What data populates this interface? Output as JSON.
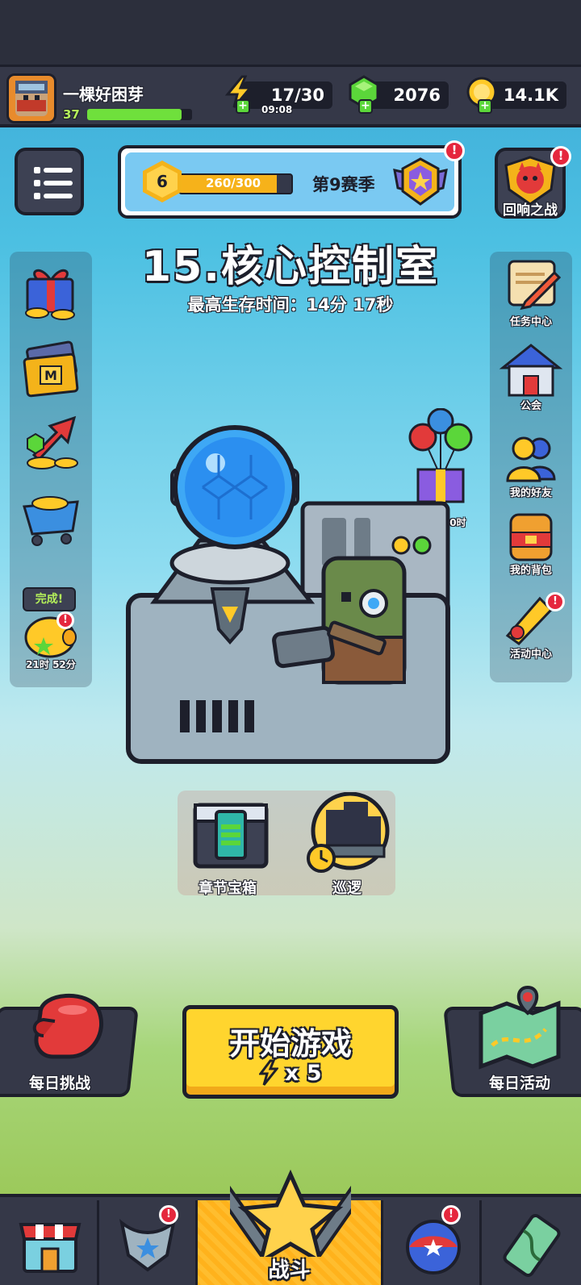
{
  "player": {
    "name": "一棵好困芽",
    "level": "37",
    "xp_fraction": 0.9
  },
  "resources": {
    "energy": {
      "value": "17/30",
      "timer": "09:08",
      "icon": "lightning-icon"
    },
    "gems": {
      "value": "2076",
      "icon": "green-gem-icon"
    },
    "coins": {
      "value": "14.1K",
      "icon": "gold-coin-icon"
    }
  },
  "season": {
    "level": "6",
    "progress": "260/300",
    "progress_fraction": 0.8667,
    "name": "第9赛季",
    "badge": "!"
  },
  "echo_battle": {
    "label": "回响之战",
    "badge": "!"
  },
  "stage": {
    "title": "15.核心控制室",
    "best_survival": "最高生存时间：14分 17秒"
  },
  "left_side": [
    {
      "icon": "gift-box-icon"
    },
    {
      "icon": "monthly-card-icon"
    },
    {
      "icon": "growth-fund-icon"
    },
    {
      "icon": "shop-cart-icon"
    },
    {
      "icon": "piggy-bank-icon",
      "status": "完成!",
      "timer": "21时 52分",
      "badge": "!"
    }
  ],
  "right_side": [
    {
      "label": "任务中心",
      "icon": "quest-scroll-icon"
    },
    {
      "label": "公会",
      "icon": "guild-house-icon"
    },
    {
      "label": "我的好友",
      "icon": "friends-icon"
    },
    {
      "label": "我的背包",
      "icon": "backpack-icon"
    },
    {
      "label": "活动中心",
      "icon": "megaphone-icon",
      "badge": "!"
    }
  ],
  "balloon_gift": {
    "timer": "06天 00时",
    "icon": "balloon-gift-icon"
  },
  "chapter_chest": {
    "label": "章节宝箱",
    "icon": "chapter-chest-icon"
  },
  "patrol": {
    "label": "巡逻",
    "icon": "patrol-icon"
  },
  "daily_challenge": {
    "label": "每日挑战",
    "icon": "boxing-glove-icon"
  },
  "start_game": {
    "label": "开始游戏",
    "cost": "x 5",
    "icon": "lightning-icon"
  },
  "daily_event": {
    "label": "每日活动",
    "icon": "map-icon"
  },
  "bottom_nav": [
    {
      "icon": "shop-icon"
    },
    {
      "icon": "equipment-icon",
      "badge": "!"
    },
    {
      "label": "战斗",
      "icon": "battle-star-icon"
    },
    {
      "icon": "talent-orb-icon",
      "badge": "!"
    },
    {
      "icon": "evolution-icon"
    }
  ]
}
